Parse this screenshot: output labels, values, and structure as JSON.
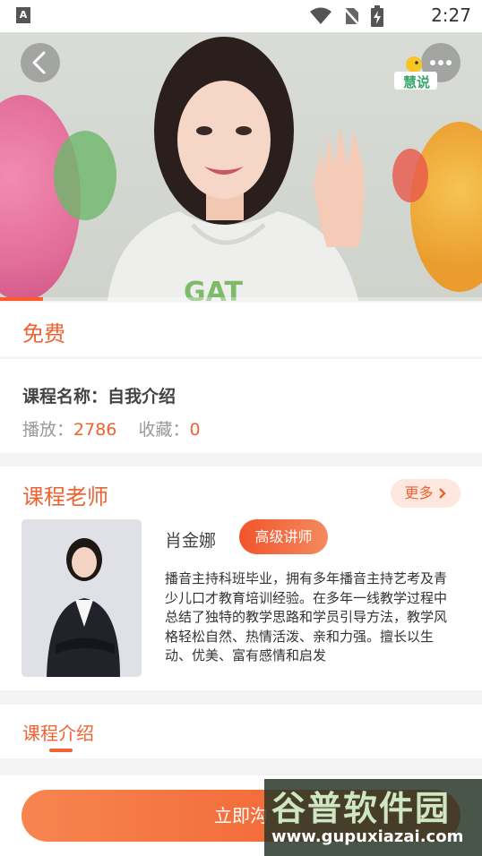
{
  "status_bar": {
    "time": "2:27",
    "app_icon": "A"
  },
  "video": {
    "logo_text": "慧说",
    "progress_fraction": 0.09
  },
  "price_label": "免费",
  "course": {
    "name_label": "课程名称：",
    "name": "自我介绍",
    "plays_label": "播放：",
    "plays": "2786",
    "favorites_label": "收藏：",
    "favorites": "0"
  },
  "teacher_section": {
    "title": "课程老师",
    "more_label": "更多",
    "teacher_name": "肖金娜",
    "badge": "高级讲师",
    "bio": "播音主持科班毕业，拥有多年播音主持艺考及青少儿口才教育培训经验。在多年一线教学过程中总结了独特的教学思路和学员引导方法，教学风格轻松自然、热情活泼、亲和力强。擅长以生动、优美、富有感情和启发"
  },
  "intro_tab": "课程介绍",
  "cta_label": "立即沟",
  "watermark": {
    "title": "谷普软件园",
    "url": "www.gupuxiazai.com"
  },
  "colors": {
    "accent": "#f06231",
    "cta_start": "#f7854f",
    "cta_end": "#f05a2b"
  }
}
